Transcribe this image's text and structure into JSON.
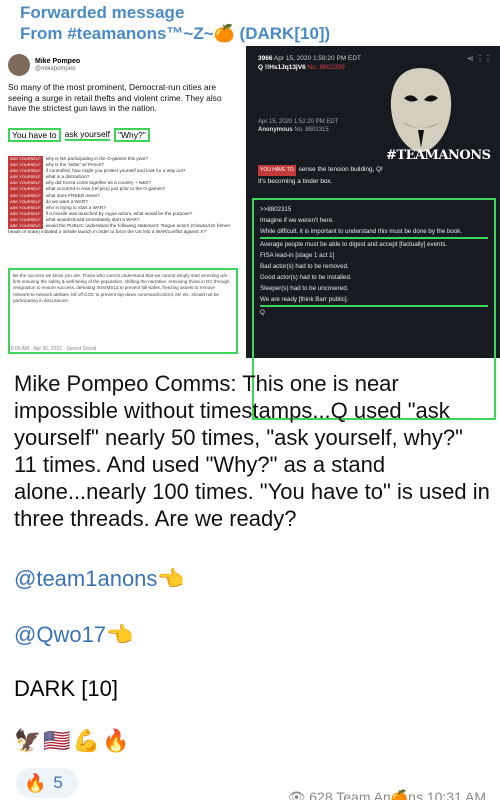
{
  "forward": {
    "title": "Forwarded message",
    "from": "From #teamanons™~Z~🍊 (DARK[10])"
  },
  "tweet": {
    "name": "Mike Pompeo",
    "handle": "@mikepompeo",
    "text": "So many of the most prominent, Democrat-run cities are seeing a surge in retail thefts and violent crime. They also have the strictest gun laws in the nation.",
    "highlight_a": "You have to",
    "highlight_b": "ask yourself",
    "highlight_c": "\"Why?\"",
    "list": [
      "why is NK participating in the O-games this year?",
      "why is the 'sister' w/ Pence?",
      "if controlled, how might you protect yourself and look for a way out?",
      "what is a distraction?",
      "why did Korea come together as a country + N&S?",
      "what occurred in Asia (ref pics) just prior to the O-games?",
      "what does FREED mean?",
      "do we want a WAR?",
      "who is trying to start a WAR?",
      "if a missile was launched by rogue actors, what would be the purpose?",
      "what would/should immediately start a WAR?",
      "would the PUBLIC understand the following statement: 'Rogue actors (Clowns/US former heads of State) initiated a missile launch in order to force the US into a WAR/conflict against X?'"
    ],
    "list_tag": "ASK YOURSELF",
    "footer_text": "Be the success we know you are. Those who cannot understand that we cannot simply start arresting w/o first ensuring the safety & well-being of the population, shifting the narrative, removing those in DC through resignation to ensure success, defeating ISIS/MS13 to prevent fall-safes, freezing assets to remove network-to-network abilities, kill off COC to prevent top-down command/control, etc etc. should not be participating in discussions.",
    "meta": "10:00 AM · Apr 26, 2022 · Sprout Social"
  },
  "qpost": {
    "num": "3966",
    "date": "Apr 15, 2020 1:59:20 PM EDT",
    "trip": "Q !!Hs1Jq13jV6",
    "post_no": "No. 8802359",
    "inner_date": "Apr 15, 2020 1:52:20 PM EDT",
    "anon": "Anonymous",
    "inner_no": "No. 8802315",
    "brand": "#TEAMANONS",
    "tag": "YOU HAVE TO",
    "line1": "sense the tension building, Q!",
    "line2": "It's becoming a tinder box.",
    "box_lines": [
      ">>8802315",
      "Imagine if we weren't here.",
      "While difficult, it is important to understand this must be done by the book.",
      "Average people must be able to digest and accept [factually] events.",
      "FISA lead-in [stage 1 act 1]",
      "Bad actor(s) had to be removed.",
      "Good actor(s) had to be installed.",
      "Sleeper(s) had to be uncovered.",
      "We are ready [think Barr public].",
      "Q"
    ]
  },
  "caption": "Mike Pompeo Comms:  This one is near impossible without timestamps...Q used \"ask yourself\" nearly 50 times, \"ask yourself, why?\" 11 times. And used \"Why?\" as a stand alone...nearly 100 times.  \"You have to\" is used in three threads.  Are we ready?",
  "links": [
    "@team1anons👈",
    "@Qwo17👈"
  ],
  "dark": "DARK [10]",
  "emojis": "🦅🇺🇸💪🔥",
  "reaction": {
    "emoji": "🔥",
    "count": "5"
  },
  "footer": "👁 628  Team An🍊ns  10:31 AM"
}
